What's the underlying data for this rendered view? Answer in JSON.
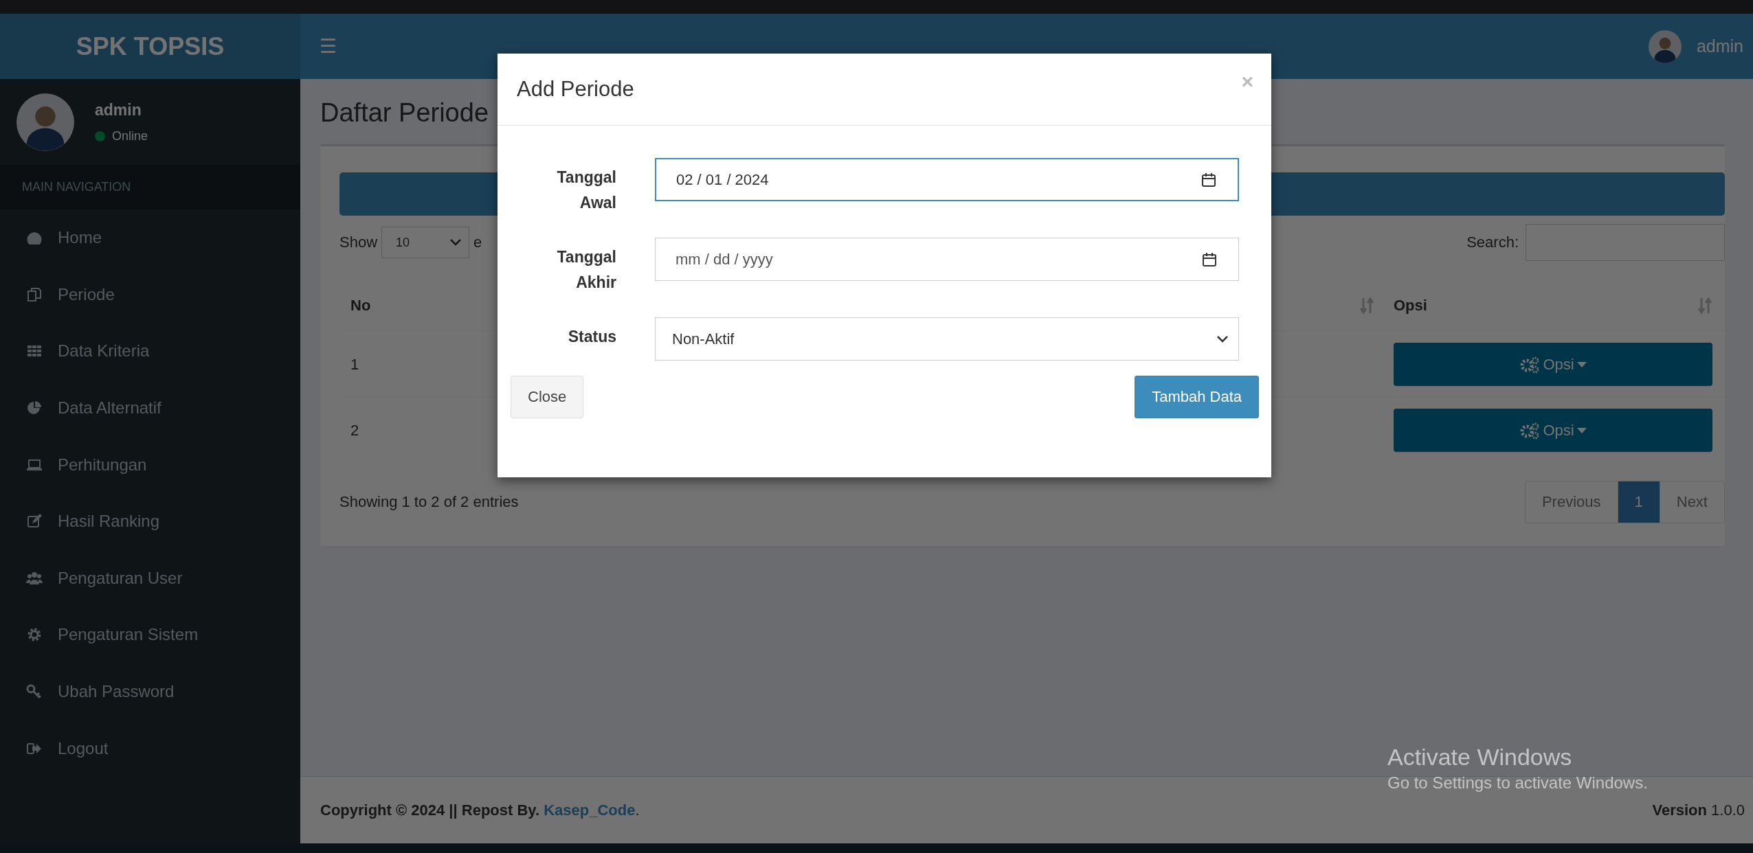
{
  "header": {
    "logo": "SPK TOPSIS",
    "menu_toggle": "☰",
    "user": "admin"
  },
  "sidebar": {
    "user": {
      "name": "admin",
      "status": "Online"
    },
    "section": "MAIN NAVIGATION",
    "items": [
      {
        "label": "Home"
      },
      {
        "label": "Periode"
      },
      {
        "label": "Data Kriteria"
      },
      {
        "label": "Data Alternatif"
      },
      {
        "label": "Perhitungan"
      },
      {
        "label": "Hasil Ranking"
      },
      {
        "label": "Pengaturan User"
      },
      {
        "label": "Pengaturan Sistem"
      },
      {
        "label": "Ubah Password"
      },
      {
        "label": "Logout"
      }
    ]
  },
  "page": {
    "title": "Daftar Periode",
    "show_label": "Show",
    "page_length": "10",
    "entries_label": "e",
    "search_label": "Search:",
    "table": {
      "columns": [
        "No",
        "Opsi"
      ],
      "rows": [
        {
          "no": "1",
          "action": "Opsi"
        },
        {
          "no": "2",
          "action": "Opsi"
        }
      ]
    },
    "info": "Showing 1 to 2 of 2 entries",
    "pagination": [
      {
        "label": "Previous",
        "selected": false
      },
      {
        "label": "1",
        "selected": true
      },
      {
        "label": "Next",
        "selected": false
      }
    ]
  },
  "footer": {
    "copyright": "**Copyright © 2024 || Repost By.**",
    "link": "Kasep_Code",
    "link_end": ".",
    "version_label": "Version",
    "version": "1.0.0"
  },
  "notice": {
    "title": "Activate Windows",
    "text": "Go to Settings to activate Windows."
  },
  "modal": {
    "title": "Add Periode",
    "close": "×",
    "fields": [
      {
        "kind": "date",
        "label": "Tanggal Awal",
        "value": "02 / 01 / 2024",
        "focused": true
      },
      {
        "kind": "date",
        "label": "Tanggal Akhir",
        "placeholder": "mm / dd / yyyy",
        "focused": false
      },
      {
        "kind": "select",
        "label": "Status",
        "value": "Non-Aktif",
        "focused": false
      }
    ],
    "buttons": [
      {
        "label": "Close",
        "kind": "default"
      },
      {
        "label": "Tambah Data",
        "kind": "primary"
      }
    ]
  }
}
